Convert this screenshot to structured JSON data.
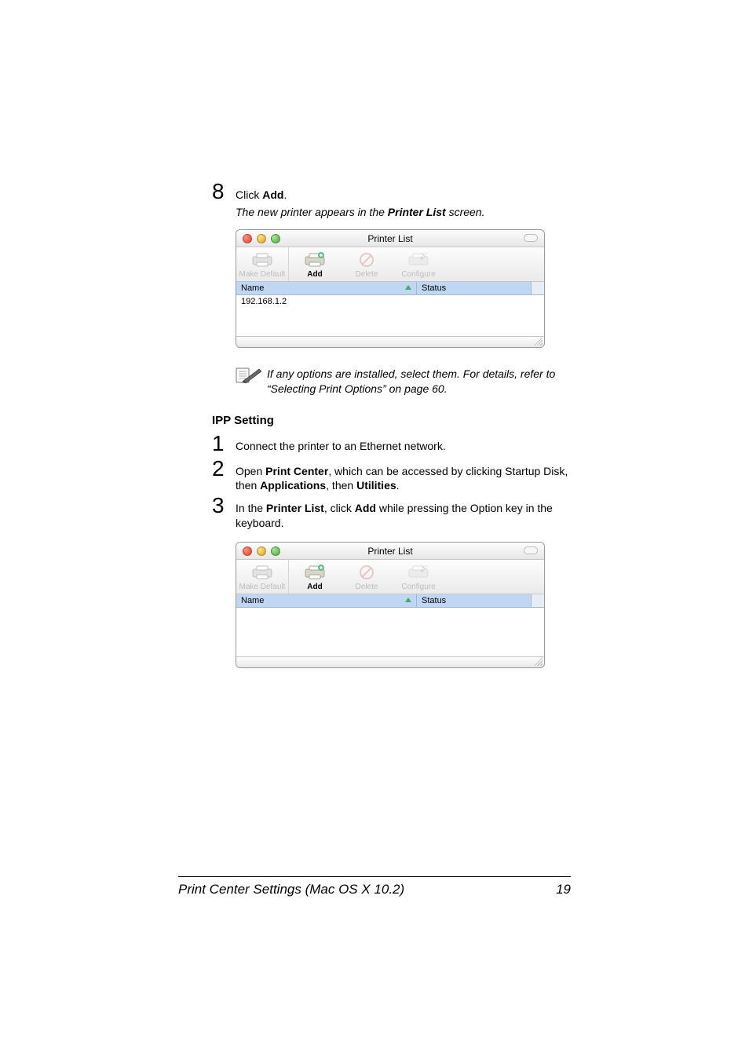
{
  "step8": {
    "num": "8",
    "pre": "Click ",
    "bold": "Add",
    "post": ".",
    "result_pre": "The new printer appears in the ",
    "result_bold": "Printer List",
    "result_post": " screen."
  },
  "window": {
    "title": "Printer List",
    "toolbar": {
      "make_default": "Make Default",
      "add": "Add",
      "delete": "Delete",
      "configure": "Configure"
    },
    "columns": {
      "name": "Name",
      "status": "Status"
    },
    "row1": "192.168.1.2"
  },
  "note": {
    "text_pre": "If any options are installed, select them. For details, refer to “Selecting Print Options” on page 60."
  },
  "section": {
    "title": "IPP Setting"
  },
  "steps": {
    "s1": {
      "num": "1",
      "text": "Connect the printer to an Ethernet network."
    },
    "s2": {
      "num": "2",
      "p1": "Open ",
      "b1": "Print Center",
      "p2": ", which can be accessed by clicking Startup Disk, then ",
      "b2": "Applications",
      "p3": ", then ",
      "b3": "Utilities",
      "p4": "."
    },
    "s3": {
      "num": "3",
      "p1": "In the ",
      "b1": "Printer List",
      "p2": ", click ",
      "b2": "Add",
      "p3": " while pressing the Option key in the keyboard."
    }
  },
  "footer": {
    "title": "Print Center Settings (Mac OS X 10.2)",
    "page": "19"
  }
}
